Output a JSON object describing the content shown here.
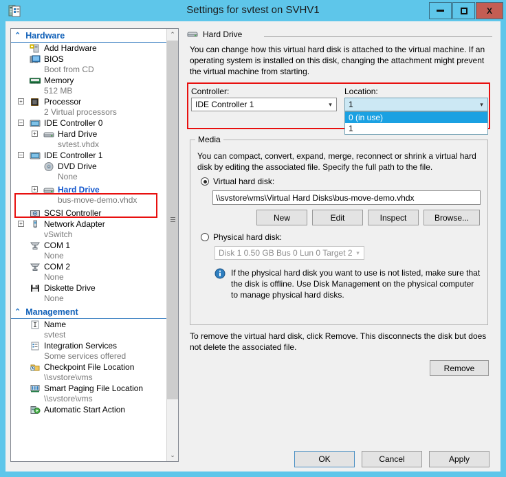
{
  "window": {
    "title": "Settings for svtest on SVHV1",
    "app_icon": "settings-document-icon",
    "minimize": "–",
    "maximize": "□",
    "close": "X"
  },
  "sidebar": {
    "sections": [
      {
        "label": "Hardware",
        "chevron": "⌃",
        "items": [
          {
            "label": "Add Hardware",
            "sub": "",
            "icon": "add-hardware-icon",
            "expander": "",
            "indent": 0,
            "highlight": false
          },
          {
            "label": "BIOS",
            "sub": "Boot from CD",
            "icon": "bios-icon",
            "expander": "",
            "indent": 0,
            "highlight": false
          },
          {
            "label": "Memory",
            "sub": "512 MB",
            "icon": "memory-icon",
            "expander": "",
            "indent": 0,
            "highlight": false
          },
          {
            "label": "Processor",
            "sub": "2 Virtual processors",
            "icon": "processor-icon",
            "expander": "+",
            "indent": 0,
            "highlight": false
          },
          {
            "label": "IDE Controller 0",
            "sub": "",
            "icon": "ide-controller-icon",
            "expander": "–",
            "indent": 0,
            "highlight": false
          },
          {
            "label": "Hard Drive",
            "sub": "svtest.vhdx",
            "icon": "hard-drive-icon",
            "expander": "+",
            "indent": 1,
            "highlight": false
          },
          {
            "label": "IDE Controller 1",
            "sub": "",
            "icon": "ide-controller-icon",
            "expander": "–",
            "indent": 0,
            "highlight": false
          },
          {
            "label": "DVD Drive",
            "sub": "None",
            "icon": "dvd-drive-icon",
            "expander": "",
            "indent": 1,
            "highlight": false
          },
          {
            "label": "Hard Drive",
            "sub": "bus-move-demo.vhdx",
            "icon": "hard-drive-icon",
            "expander": "+",
            "indent": 1,
            "highlight": true
          },
          {
            "label": "SCSI Controller",
            "sub": "",
            "icon": "scsi-controller-icon",
            "expander": "",
            "indent": 0,
            "highlight": false
          },
          {
            "label": "Network Adapter",
            "sub": "vSwitch",
            "icon": "network-adapter-icon",
            "expander": "+",
            "indent": 0,
            "highlight": false
          },
          {
            "label": "COM 1",
            "sub": "None",
            "icon": "com-port-icon",
            "expander": "",
            "indent": 0,
            "highlight": false
          },
          {
            "label": "COM 2",
            "sub": "None",
            "icon": "com-port-icon",
            "expander": "",
            "indent": 0,
            "highlight": false
          },
          {
            "label": "Diskette Drive",
            "sub": "None",
            "icon": "diskette-drive-icon",
            "expander": "",
            "indent": 0,
            "highlight": false
          }
        ]
      },
      {
        "label": "Management",
        "chevron": "⌃",
        "items": [
          {
            "label": "Name",
            "sub": "svtest",
            "icon": "name-icon",
            "expander": "",
            "indent": 0,
            "highlight": false
          },
          {
            "label": "Integration Services",
            "sub": "Some services offered",
            "icon": "integration-services-icon",
            "expander": "",
            "indent": 0,
            "highlight": false
          },
          {
            "label": "Checkpoint File Location",
            "sub": "\\\\svstore\\vms",
            "icon": "checkpoint-folder-icon",
            "expander": "",
            "indent": 0,
            "highlight": false
          },
          {
            "label": "Smart Paging File Location",
            "sub": "\\\\svstore\\vms",
            "icon": "smart-paging-icon",
            "expander": "",
            "indent": 0,
            "highlight": false
          },
          {
            "label": "Automatic Start Action",
            "sub": "",
            "icon": "automatic-start-icon",
            "expander": "",
            "indent": 0,
            "highlight": false
          }
        ]
      }
    ],
    "scroll_up": "⌃",
    "scroll_down": "⌄"
  },
  "pane": {
    "group_title": "Hard Drive",
    "group_icon": "hard-drive-icon",
    "description": "You can change how this virtual hard disk is attached to the virtual machine. If an operating system is installed on this disk, changing the attachment might prevent the virtual machine from starting.",
    "controller_label": "Controller:",
    "controller_value": "IDE Controller 1",
    "location_label": "Location:",
    "location_value": "1",
    "location_options": [
      {
        "label": "0 (in use)",
        "selected": true
      },
      {
        "label": "1",
        "selected": false
      }
    ],
    "media_caption": "Media",
    "media_description": "You can compact, convert, expand, merge, reconnect or shrink a virtual hard disk by editing the associated file. Specify the full path to the file.",
    "virtual_disk_label": "Virtual hard disk:",
    "virtual_disk_path": "\\\\svstore\\vms\\Virtual Hard Disks\\bus-move-demo.vhdx",
    "buttons": {
      "new": "New",
      "edit": "Edit",
      "inspect": "Inspect",
      "browse": "Browse..."
    },
    "physical_disk_label": "Physical hard disk:",
    "physical_disk_value": "Disk 1 0.50 GB Bus 0 Lun 0 Target 2",
    "info_icon": "info-icon",
    "info_text": "If the physical hard disk you want to use is not listed, make sure that the disk is offline. Use Disk Management on the physical computer to manage physical hard disks.",
    "remove_note": "To remove the virtual hard disk, click Remove. This disconnects the disk but does not delete the associated file.",
    "remove_button": "Remove"
  },
  "footer": {
    "ok": "OK",
    "cancel": "Cancel",
    "apply": "Apply"
  },
  "colors": {
    "title_bar": "#5ec6ea",
    "close_button": "#c45d53",
    "highlight_box": "#e8100f",
    "selection_blue": "#1ba1e2",
    "link_blue": "#1155cc",
    "section_header": "#1060b8"
  }
}
